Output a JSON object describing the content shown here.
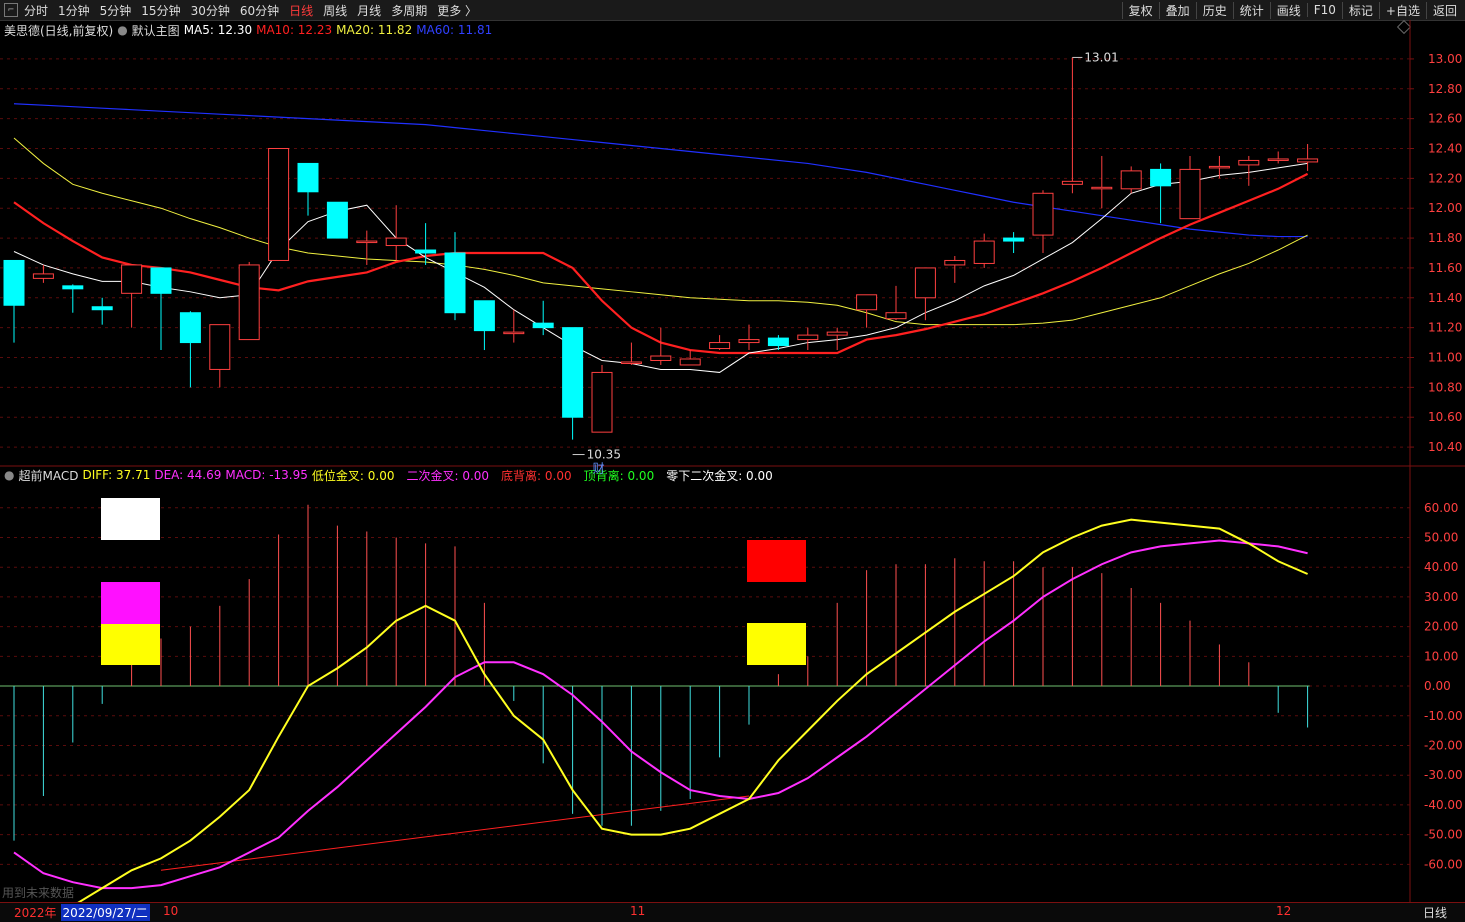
{
  "toolbar": {
    "tabs": [
      "分时",
      "1分钟",
      "5分钟",
      "15分钟",
      "30分钟",
      "60分钟",
      "日线",
      "周线",
      "月线",
      "多周期",
      "更多 〉"
    ],
    "active_tab": "日线",
    "right_buttons": [
      "复权",
      "叠加",
      "历史",
      "统计",
      "画线",
      "F10",
      "标记",
      "+自选",
      "返回"
    ]
  },
  "main_info": {
    "stock": "美思德(日线,前复权)",
    "chart_name": "默认主图",
    "ma5": "MA5: 12.30",
    "ma10": "MA10: 12.23",
    "ma20": "MA20: 11.82",
    "ma60": "MA60: 11.81"
  },
  "macd_info": {
    "name": "超前MACD",
    "diff": "DIFF: 37.71",
    "dea": "DEA: 44.69",
    "macd": "MACD: -13.95",
    "low_cross": "低位金叉: 0.00",
    "second_cross": "二次金叉: 0.00",
    "bottom_div": "底背离: 0.00",
    "top_div": "顶背离: 0.00",
    "zero_second_cross": "零下二次金叉: 0.00"
  },
  "annotations": {
    "high_label": "13.01",
    "low_label": "10.35",
    "cai_label": "财"
  },
  "bottom": {
    "year": "2022年",
    "date": "2022/09/27/二",
    "months": [
      "10",
      "11",
      "12"
    ],
    "period": "日线",
    "note": "用到未来数据"
  },
  "colors": {
    "ma5": "#ffffff",
    "ma10": "#ff2020",
    "ma20": "#f0f040",
    "ma60": "#2030ff",
    "up": "#ff4040",
    "down": "#00ffff",
    "diff": "#ffff20",
    "dea": "#ff30ff"
  },
  "chart_data": {
    "type": "candlestick",
    "price_axis": {
      "min": 10.3,
      "max": 13.1,
      "ticks": [
        "13.00",
        "12.80",
        "12.60",
        "12.40",
        "12.20",
        "12.00",
        "11.80",
        "11.60",
        "11.40",
        "11.20",
        "11.00",
        "10.80",
        "10.60",
        "10.40"
      ]
    },
    "macd_axis": {
      "min": -72,
      "max": 68,
      "ticks": [
        "60.00",
        "50.00",
        "40.00",
        "30.00",
        "20.00",
        "10.00",
        "0.00",
        "-10.00",
        "-20.00",
        "-30.00",
        "-40.00",
        "-50.00",
        "-60.00"
      ]
    },
    "candles": [
      [
        11.65,
        11.35,
        11.1,
        11.65
      ],
      [
        11.53,
        11.56,
        11.5,
        11.62
      ],
      [
        11.48,
        11.46,
        11.3,
        11.49
      ],
      [
        11.34,
        11.32,
        11.22,
        11.4
      ],
      [
        11.43,
        11.62,
        11.2,
        11.62
      ],
      [
        11.6,
        11.43,
        11.05,
        11.6
      ],
      [
        11.3,
        11.1,
        10.8,
        11.31
      ],
      [
        10.92,
        11.22,
        10.8,
        11.22
      ],
      [
        11.12,
        11.62,
        11.12,
        11.64
      ],
      [
        11.65,
        12.4,
        11.65,
        12.4
      ],
      [
        12.3,
        12.11,
        11.95,
        12.3
      ],
      [
        12.04,
        11.8,
        11.8,
        12.04
      ],
      [
        11.78,
        11.78,
        11.62,
        11.85
      ],
      [
        11.75,
        11.8,
        11.65,
        12.02
      ],
      [
        11.72,
        11.7,
        11.62,
        11.9
      ],
      [
        11.7,
        11.3,
        11.25,
        11.84
      ],
      [
        11.38,
        11.18,
        11.05,
        11.38
      ],
      [
        11.17,
        11.17,
        11.1,
        11.32
      ],
      [
        11.23,
        11.2,
        11.15,
        11.38
      ],
      [
        11.2,
        10.6,
        10.45,
        11.2
      ],
      [
        10.5,
        10.9,
        10.5,
        10.95
      ],
      [
        10.97,
        10.97,
        10.95,
        11.1
      ],
      [
        10.98,
        11.01,
        10.95,
        11.2
      ],
      [
        10.95,
        10.99,
        10.95,
        11.05
      ],
      [
        11.06,
        11.1,
        11.05,
        11.15
      ],
      [
        11.1,
        11.12,
        11.05,
        11.22
      ],
      [
        11.13,
        11.08,
        11.05,
        11.15
      ],
      [
        11.12,
        11.15,
        11.05,
        11.2
      ],
      [
        11.15,
        11.17,
        11.05,
        11.2
      ],
      [
        11.32,
        11.42,
        11.2,
        11.42
      ],
      [
        11.26,
        11.3,
        11.25,
        11.48
      ],
      [
        11.4,
        11.6,
        11.25,
        11.6
      ],
      [
        11.62,
        11.65,
        11.5,
        11.68
      ],
      [
        11.63,
        11.78,
        11.6,
        11.83
      ],
      [
        11.8,
        11.78,
        11.7,
        11.84
      ],
      [
        11.82,
        12.1,
        11.7,
        12.12
      ],
      [
        12.16,
        12.18,
        12.1,
        13.01
      ],
      [
        12.13,
        12.14,
        12.0,
        12.35
      ],
      [
        12.13,
        12.25,
        12.1,
        12.28
      ],
      [
        12.26,
        12.15,
        11.9,
        12.3
      ],
      [
        11.93,
        12.26,
        11.93,
        12.35
      ],
      [
        12.27,
        12.28,
        12.2,
        12.35
      ],
      [
        12.29,
        12.32,
        12.15,
        12.35
      ],
      [
        12.32,
        12.33,
        12.3,
        12.38
      ],
      [
        12.31,
        12.33,
        12.25,
        12.43
      ]
    ],
    "ma5": [
      11.71,
      11.62,
      11.56,
      11.51,
      11.51,
      11.47,
      11.44,
      11.4,
      11.42,
      11.72,
      11.91,
      11.98,
      12.02,
      11.8,
      11.67,
      11.57,
      11.47,
      11.32,
      11.2,
      11.08,
      10.98,
      10.96,
      10.92,
      10.92,
      10.9,
      11.03,
      11.06,
      11.1,
      11.12,
      11.15,
      11.2,
      11.3,
      11.38,
      11.48,
      11.55,
      11.66,
      11.77,
      11.93,
      12.1,
      12.16,
      12.18,
      12.22,
      12.24,
      12.27,
      12.3
    ],
    "ma10": [
      12.04,
      11.9,
      11.78,
      11.67,
      11.62,
      11.6,
      11.57,
      11.52,
      11.47,
      11.45,
      11.51,
      11.54,
      11.57,
      11.64,
      11.68,
      11.7,
      11.7,
      11.7,
      11.7,
      11.6,
      11.38,
      11.2,
      11.1,
      11.05,
      11.03,
      11.03,
      11.03,
      11.03,
      11.03,
      11.12,
      11.15,
      11.19,
      11.24,
      11.29,
      11.36,
      11.43,
      11.51,
      11.6,
      11.7,
      11.8,
      11.89,
      11.97,
      12.05,
      12.13,
      12.23
    ],
    "ma20": [
      12.47,
      12.3,
      12.16,
      12.1,
      12.05,
      12.0,
      11.93,
      11.87,
      11.8,
      11.74,
      11.7,
      11.68,
      11.66,
      11.65,
      11.64,
      11.62,
      11.59,
      11.55,
      11.5,
      11.48,
      11.46,
      11.44,
      11.42,
      11.4,
      11.39,
      11.38,
      11.38,
      11.37,
      11.35,
      11.3,
      11.24,
      11.22,
      11.22,
      11.22,
      11.22,
      11.23,
      11.25,
      11.3,
      11.35,
      11.4,
      11.48,
      11.56,
      11.63,
      11.72,
      11.82
    ],
    "ma60": [
      12.7,
      12.69,
      12.68,
      12.67,
      12.66,
      12.65,
      12.64,
      12.63,
      12.62,
      12.61,
      12.6,
      12.59,
      12.58,
      12.57,
      12.56,
      12.54,
      12.52,
      12.5,
      12.48,
      12.46,
      12.44,
      12.42,
      12.4,
      12.38,
      12.36,
      12.34,
      12.32,
      12.3,
      12.27,
      12.24,
      12.2,
      12.16,
      12.12,
      12.08,
      12.04,
      12.01,
      11.98,
      11.95,
      11.92,
      11.89,
      11.86,
      11.84,
      11.82,
      11.81,
      11.81
    ],
    "diff": [
      -80,
      -78,
      -74,
      -68,
      -62,
      -58,
      -52,
      -44,
      -35,
      -17,
      0,
      6,
      13,
      22,
      27,
      22,
      4,
      -10,
      -18,
      -35,
      -48,
      -50,
      -50,
      -48,
      -43,
      -38,
      -25,
      -15,
      -5,
      4,
      11,
      18,
      25,
      31,
      37,
      45,
      50,
      54,
      56,
      55,
      54,
      53,
      48,
      42,
      37.71
    ],
    "dea": [
      -56,
      -63,
      -66,
      -68,
      -68,
      -67,
      -64,
      -61,
      -56,
      -51,
      -42,
      -34,
      -25,
      -16,
      -7,
      3,
      8,
      8,
      4,
      -3,
      -12,
      -22,
      -29,
      -35,
      -37,
      -38,
      -36,
      -31,
      -24,
      -17,
      -9,
      -1,
      7,
      15,
      22,
      30,
      36,
      41,
      45,
      47,
      48,
      49,
      48,
      47,
      44.69
    ],
    "macd": [
      -52,
      -37,
      -19,
      -6,
      10,
      16,
      20,
      27,
      36,
      51,
      61,
      54,
      52,
      50,
      48,
      47,
      28,
      -5,
      -26,
      -43,
      -47,
      -47,
      -42,
      -38,
      -24,
      -13,
      4,
      10,
      28,
      39,
      41,
      41,
      43,
      42,
      42,
      40,
      40,
      38,
      33,
      28,
      22,
      14,
      8,
      -9,
      -13.95
    ]
  }
}
